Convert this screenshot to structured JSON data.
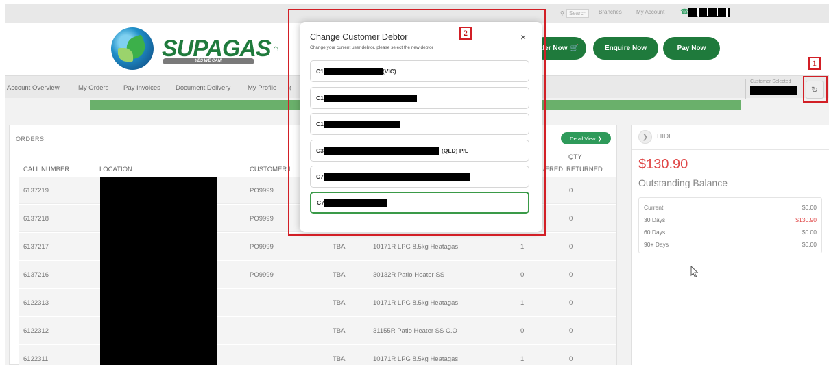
{
  "topbar": {
    "search_label": "Search",
    "branches": "Branches",
    "my_account": "My Account"
  },
  "header": {
    "brand": "SUPAGAS",
    "tagline": "YES WE CAN!",
    "buttons": {
      "order_now": "der Now",
      "enquire_now": "Enquire Now",
      "pay_now": "Pay Now"
    }
  },
  "nav": {
    "items": [
      "Account Overview",
      "My Orders",
      "Pay Invoices",
      "Document Delivery",
      "My Profile",
      "("
    ],
    "customer_selected_label": "Customer Selected"
  },
  "orders": {
    "title": "ORDERS",
    "detail_view": "Detail View",
    "columns": {
      "call_number": "CALL NUMBER",
      "location": "LOCATION",
      "customer": "CUSTOMER I",
      "delivered": "/ERED",
      "qty": "QTY",
      "returned": "RETURNED"
    },
    "rows": [
      {
        "call": "6137219",
        "po": "PO9999",
        "date": "",
        "product": "",
        "delivered": "",
        "returned": "0"
      },
      {
        "call": "6137218",
        "po": "PO9999",
        "date": "",
        "product": "",
        "delivered": "",
        "returned": "0"
      },
      {
        "call": "6137217",
        "po": "PO9999",
        "date": "TBA",
        "product": "10171R LPG 8.5kg Heatagas",
        "delivered": "1",
        "returned": "0"
      },
      {
        "call": "6137216",
        "po": "PO9999",
        "date": "TBA",
        "product": "30132R Patio Heater SS",
        "delivered": "0",
        "returned": "0"
      },
      {
        "call": "6122313",
        "po": "",
        "date": "TBA",
        "product": "10171R LPG 8.5kg Heatagas",
        "delivered": "1",
        "returned": "0"
      },
      {
        "call": "6122312",
        "po": "",
        "date": "TBA",
        "product": "31155R Patio Heater SS C.O",
        "delivered": "0",
        "returned": "0"
      },
      {
        "call": "6122311",
        "po": "",
        "date": "TBA",
        "product": "10171R LPG 8.5kg Heatagas",
        "delivered": "1",
        "returned": "0"
      }
    ]
  },
  "side": {
    "hide": "HIDE",
    "balance": "$130.90",
    "balance_label": "Outstanding Balance",
    "aging": [
      {
        "label": "Current",
        "value": "$0.00",
        "alert": false
      },
      {
        "label": "30 Days",
        "value": "$130.90",
        "alert": true
      },
      {
        "label": "60 Days",
        "value": "$0.00",
        "alert": false
      },
      {
        "label": "90+ Days",
        "value": "$0.00",
        "alert": false
      }
    ]
  },
  "modal": {
    "title": "Change Customer Debtor",
    "subtitle": "Change your current user debtor, please select the new debtor",
    "close": "×",
    "debtors": [
      {
        "prefix": "C1",
        "suffix": "(VIC)",
        "selected": false
      },
      {
        "prefix": "C1",
        "suffix": "",
        "selected": false
      },
      {
        "prefix": "C1",
        "suffix": "",
        "selected": false
      },
      {
        "prefix": "C3",
        "suffix": "(QLD) P/L",
        "selected": false
      },
      {
        "prefix": "C7",
        "suffix": "",
        "selected": false
      },
      {
        "prefix": "C7",
        "suffix": "",
        "selected": true
      }
    ]
  },
  "annotations": {
    "one": "1",
    "two": "2"
  },
  "colors": {
    "brand_green": "#1f7a3c",
    "alert_red": "#e04848",
    "annotation_red": "#d21f26"
  }
}
